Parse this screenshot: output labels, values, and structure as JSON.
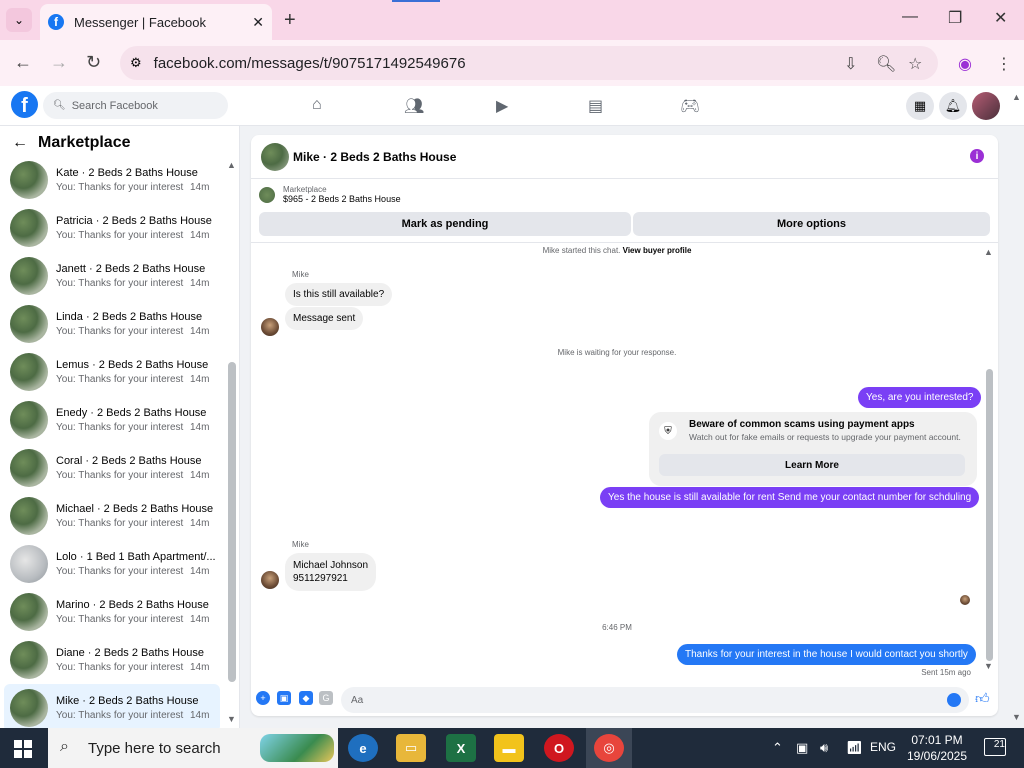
{
  "browser": {
    "tab_title": "Messenger | Facebook",
    "url": "facebook.com/messages/t/9075171492549676"
  },
  "fb": {
    "search_placeholder": "Search Facebook"
  },
  "sidebar": {
    "heading": "Marketplace",
    "conversations": [
      {
        "name": "Kate · 2 Beds 2 Baths House",
        "preview": "You: Thanks for your interest in t...",
        "time": "14m"
      },
      {
        "name": "Patricia · 2 Beds 2 Baths House",
        "preview": "You: Thanks for your interest in t...",
        "time": "14m"
      },
      {
        "name": "Janett · 2 Beds 2 Baths House",
        "preview": "You: Thanks for your interest in t...",
        "time": "14m"
      },
      {
        "name": "Linda · 2 Beds 2 Baths House",
        "preview": "You: Thanks for your interest in t...",
        "time": "14m"
      },
      {
        "name": "Lemus · 2 Beds 2 Baths House",
        "preview": "You: Thanks for your interest in t...",
        "time": "14m"
      },
      {
        "name": "Enedy · 2 Beds 2 Baths House",
        "preview": "You: Thanks for your interest in t...",
        "time": "14m"
      },
      {
        "name": "Coral · 2 Beds 2 Baths House",
        "preview": "You: Thanks for your interest in t...",
        "time": "14m"
      },
      {
        "name": "Michael · 2 Beds 2 Baths House",
        "preview": "You: Thanks for your interest in t...",
        "time": "14m"
      },
      {
        "name": "Lolo · 1 Bed 1 Bath Apartment/...",
        "preview": "You: Thanks for your interest in t...",
        "time": "14m"
      },
      {
        "name": "Marino · 2 Beds 2 Baths House",
        "preview": "You: Thanks for your interest in t...",
        "time": "14m"
      },
      {
        "name": "Diane · 2 Beds 2 Baths House",
        "preview": "You: Thanks for your interest in t...",
        "time": "14m"
      },
      {
        "name": "Mike · 2 Beds 2 Baths House",
        "preview": "You: Thanks for your interest in t...",
        "time": "14m"
      }
    ]
  },
  "chat": {
    "title": "Mike · 2 Beds 2 Baths House",
    "listing_source": "Marketplace",
    "listing_price": "$965 - 2 Beds 2 Baths House",
    "mark_pending": "Mark as pending",
    "more_options": "More options",
    "started_text": "Mike started this chat.",
    "view_profile": "View buyer profile",
    "sender_name": "Mike",
    "msg1": "Is this still available?",
    "msg2": "Message sent",
    "waiting": "Mike is waiting for your response.",
    "out1": "Yes, are you interested?",
    "scam_title": "Beware of common scams using payment apps",
    "scam_desc": "Watch out for fake emails or requests to upgrade your payment account.",
    "learn_more": "Learn More",
    "out2": "Yes the house is still available for rent Send me your contact number for schduling",
    "sender_name2": "Mike",
    "msg3_line1": "Michael Johnson",
    "msg3_line2": "9511297921",
    "timestamp": "6:46 PM",
    "out3": "Thanks for your interest in the house I would contact you shortly",
    "sent_status": "Sent 15m ago",
    "composer_placeholder": "Aa"
  },
  "taskbar": {
    "search_placeholder": "Type here to search",
    "lang": "ENG",
    "time": "07:01 PM",
    "date": "19/06/2025",
    "notifications": "21"
  },
  "colors": {
    "fb_blue": "#1877f2",
    "outgoing_purple": "#7a3ff5",
    "outgoing_blue": "#2478f5",
    "active_conv_bg": "#e7f3ff"
  }
}
